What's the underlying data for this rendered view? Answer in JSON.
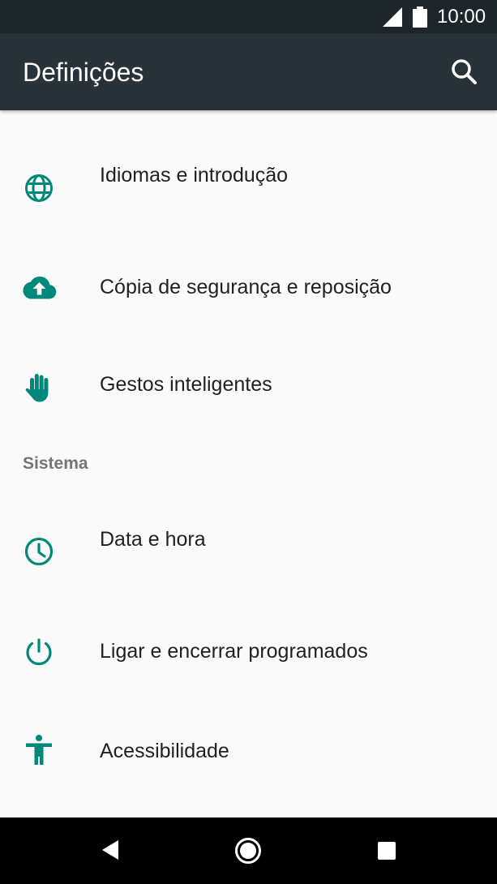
{
  "status_bar": {
    "time": "10:00",
    "signal_icon": "signal-icon",
    "battery_icon": "battery-icon"
  },
  "app_bar": {
    "title": "Definições",
    "search_icon": "search-icon"
  },
  "accent_color": "#00897b",
  "items": [
    {
      "label": "Idiomas e introdução",
      "icon": "globe-icon"
    },
    {
      "label": "Cópia de segurança e reposição",
      "icon": "cloud-upload-icon"
    },
    {
      "label": "Gestos inteligentes",
      "icon": "hand-icon"
    }
  ],
  "section": {
    "label": "Sistema"
  },
  "system_items": [
    {
      "label": "Data e hora",
      "icon": "clock-icon"
    },
    {
      "label": "Ligar e encerrar programados",
      "icon": "power-icon"
    },
    {
      "label": "Acessibilidade",
      "icon": "accessibility-icon"
    }
  ],
  "nav_bar": {
    "back_icon": "back-icon",
    "home_icon": "home-icon",
    "recents_icon": "recents-icon"
  }
}
